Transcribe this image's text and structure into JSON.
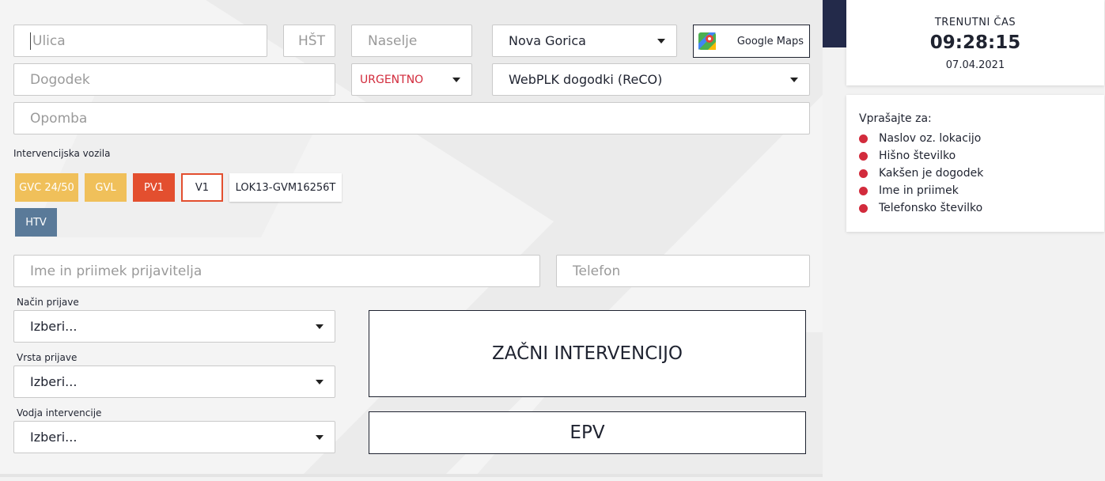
{
  "fields": {
    "ulica": "Ulica",
    "hst": "HŠT",
    "naselje": "Naselje",
    "dogodek": "Dogodek",
    "opomba": "Opomba",
    "ime": "Ime in priimek prijavitelja",
    "telefon": "Telefon"
  },
  "selects": {
    "obcina": "Nova Gorica",
    "prioriteta": "URGENTNO",
    "seznam": "WebPLK dogodki (ReCO)",
    "nacin": "Izberi...",
    "vrsta": "Izberi...",
    "vodja": "Izberi..."
  },
  "google_maps_label": "Google Maps",
  "labels": {
    "vozila": "Intervencijska vozila",
    "nacin": "Način prijave",
    "vrsta": "Vrsta prijave",
    "vodja": "Vodja intervencije"
  },
  "vehicles": [
    "GVC 24/50",
    "GVL",
    "PV1",
    "V1",
    "LOK13-GVM16256T",
    "HTV"
  ],
  "buttons": {
    "start": "ZAČNI INTERVENCIJO",
    "epv": "EPV"
  },
  "clock": {
    "label": "TRENUTNI ČAS",
    "time": "09:28:15",
    "date": "07.04.2021"
  },
  "ask": {
    "title": "Vprašajte za:",
    "items": [
      "Naslov oz. lokacijo",
      "Hišno številko",
      "Kakšen je dogodek",
      "Ime in priimek",
      "Telefonsko številko"
    ]
  },
  "colors": {
    "navy": "#232a4a",
    "red": "#e34f2f",
    "yellow": "#f0c05a",
    "slate": "#5a7a99",
    "dot": "#d22b3c"
  }
}
